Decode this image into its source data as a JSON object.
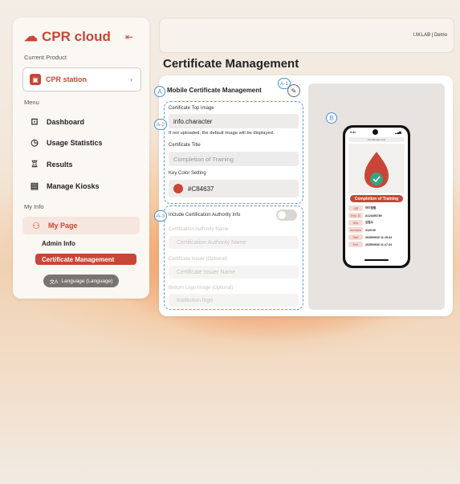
{
  "sidebar": {
    "brand": "CPR cloud",
    "current_product_label": "Current Product",
    "product": "CPR station",
    "menu_label": "Menu",
    "menu": [
      {
        "label": "Dashboard",
        "icon": "chart-icon"
      },
      {
        "label": "Usage Statistics",
        "icon": "statistics-icon"
      },
      {
        "label": "Results",
        "icon": "trophy-icon"
      },
      {
        "label": "Manage Kiosks",
        "icon": "kiosk-icon"
      }
    ],
    "myinfo_label": "My Info",
    "mypage": "My Page",
    "sub_items": [
      "Admin Info",
      "Certificate Management"
    ],
    "language_button": "Language (Language)"
  },
  "header": {
    "user_text": "I.M.LAB | Demo"
  },
  "page_title": "Certificate Management",
  "markers": {
    "a": "A",
    "a1": "A-1",
    "a2": "A-2",
    "a3": "A-3",
    "b": "B"
  },
  "form": {
    "section_title": "Mobile Certificate Management",
    "top_image_label": "Certificate Top Image",
    "top_image_value": "info.character",
    "top_image_hint": "If not uploaded, the default image will be displayed.",
    "title_label": "Certificate Title",
    "title_placeholder": "Completion of Training",
    "color_label": "Key Color Setting",
    "color_value": "#C84637",
    "authority_toggle_label": "Include Certification Authority Info",
    "authority_name_label": "Certification Authority Name",
    "authority_name_placeholder": "Certification Authority Name",
    "issuer_label": "Certificate Issuer (Optional)",
    "issuer_placeholder": "Certificate Issuer Name",
    "logo_label": "Bottom Logo Image (Optional)",
    "logo_placeholder": "Institution logo"
  },
  "preview": {
    "time": "9:41",
    "url": "Yourdomain.com",
    "banner": "Completion of Training",
    "rows": [
      {
        "key": "사용",
        "value": "아이엠랩"
      },
      {
        "key": "Emp. ID",
        "value": "A123456789"
      },
      {
        "key": "Nick",
        "value": "김철수"
      },
      {
        "key": "Serviceid",
        "value": "2120.00"
      },
      {
        "key": "Start",
        "value": "2025/09/30 11:15:24"
      },
      {
        "key": "End",
        "value": "2025/09/30 11:17:24"
      }
    ]
  },
  "colors": {
    "accent": "#C84637",
    "marker": "#4A90D9"
  }
}
